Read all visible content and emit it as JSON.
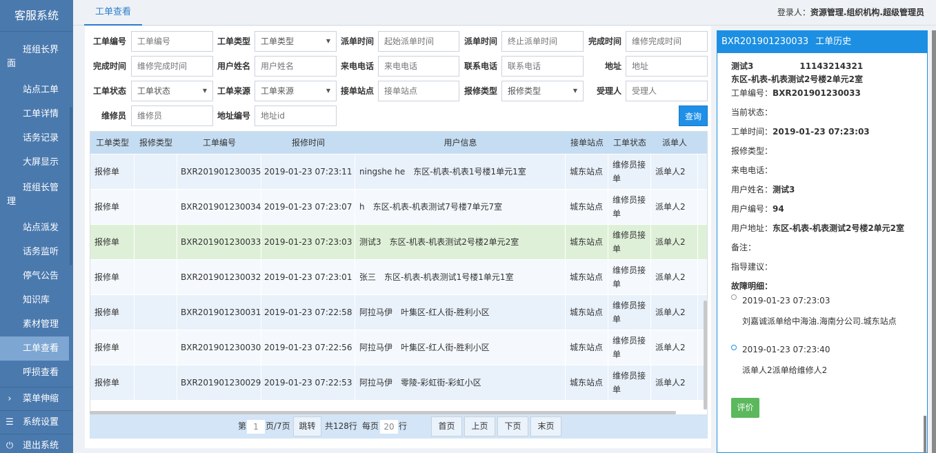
{
  "app": {
    "title": "客服系统"
  },
  "sidebar": {
    "items": [
      {
        "label": "班组长界面"
      },
      {
        "label": "站点工单"
      },
      {
        "label": "工单详情"
      },
      {
        "label": "话务记录"
      },
      {
        "label": "大屏显示"
      },
      {
        "label": "班组长管理"
      },
      {
        "label": "站点派发"
      },
      {
        "label": "话务监听"
      },
      {
        "label": "停气公告"
      },
      {
        "label": "知识库"
      },
      {
        "label": "素材管理"
      },
      {
        "label": "工单查看"
      },
      {
        "label": "呼损查看"
      }
    ],
    "bottom": {
      "menu_toggle": "菜单伸缩",
      "settings": "系统设置",
      "logout": "退出系统",
      "menu_icon": "›",
      "settings_icon": "☰",
      "logout_icon": "⏻"
    }
  },
  "topbar": {
    "tab": "工单查看",
    "login_label": "登录人：",
    "login_user": "资源管理.组织机构.超级管理员"
  },
  "filters": {
    "order_no": {
      "label": "工单编号",
      "placeholder": "工单编号"
    },
    "order_type": {
      "label": "工单类型",
      "value": "工单类型"
    },
    "dispatch_start": {
      "label": "派单时间",
      "placeholder": "起始派单时间"
    },
    "dispatch_end": {
      "label": "派单时间",
      "placeholder": "终止派单时间"
    },
    "finish_time1": {
      "label": "完成时间",
      "placeholder": "维修完成时间"
    },
    "finish_time2": {
      "label": "完成时间",
      "placeholder": "维修完成时间"
    },
    "user_name": {
      "label": "用户姓名",
      "placeholder": "用户姓名"
    },
    "incoming_phone": {
      "label": "来电电话",
      "placeholder": "来电电话"
    },
    "contact_phone": {
      "label": "联系电话",
      "placeholder": "联系电话"
    },
    "address": {
      "label": "地址",
      "placeholder": "地址"
    },
    "order_status": {
      "label": "工单状态",
      "value": "工单状态"
    },
    "order_source": {
      "label": "工单来源",
      "value": "工单来源"
    },
    "receiving_station": {
      "label": "接单站点",
      "placeholder": "接单站点"
    },
    "repair_type": {
      "label": "报修类型",
      "value": "报修类型"
    },
    "acceptor": {
      "label": "受理人",
      "placeholder": "受理人"
    },
    "repairman": {
      "label": "维修员",
      "placeholder": "维修员"
    },
    "address_id": {
      "label": "地址编号",
      "placeholder": "地址id"
    },
    "query_button": "查询"
  },
  "table": {
    "headers": [
      "工单类型",
      "报修类型",
      "工单编号",
      "报修时间",
      "用户信息",
      "接单站点",
      "工单状态",
      "派单人"
    ],
    "rows": [
      {
        "type": "报修单",
        "repair_type": "",
        "no": "BXR201901230035",
        "time": "2019-01-23 07:23:11",
        "user": "ningshe he　东区-机表-机表1号楼1单元1室",
        "station": "城东站点",
        "status": "维修员接单",
        "dispatcher": "派单人2"
      },
      {
        "type": "报修单",
        "repair_type": "",
        "no": "BXR201901230034",
        "time": "2019-01-23 07:23:07",
        "user": "h　东区-机表-机表测试7号楼7单元7室",
        "station": "城东站点",
        "status": "维修员接单",
        "dispatcher": "派单人2"
      },
      {
        "type": "报修单",
        "repair_type": "",
        "no": "BXR201901230033",
        "time": "2019-01-23 07:23:03",
        "user": "测试3　东区-机表-机表测试2号楼2单元2室",
        "station": "城东站点",
        "status": "维修员接单",
        "dispatcher": "派单人2"
      },
      {
        "type": "报修单",
        "repair_type": "",
        "no": "BXR201901230032",
        "time": "2019-01-23 07:23:01",
        "user": "张三　东区-机表-机表测试1号楼1单元1室",
        "station": "城东站点",
        "status": "维修员接单",
        "dispatcher": "派单人2"
      },
      {
        "type": "报修单",
        "repair_type": "",
        "no": "BXR201901230031",
        "time": "2019-01-23 07:22:58",
        "user": "阿拉马伊　叶集区-红人街-胜利小区",
        "station": "城东站点",
        "status": "维修员接单",
        "dispatcher": "派单人2"
      },
      {
        "type": "报修单",
        "repair_type": "",
        "no": "BXR201901230030",
        "time": "2019-01-23 07:22:56",
        "user": "阿拉马伊　叶集区-红人街-胜利小区",
        "station": "城东站点",
        "status": "维修员接单",
        "dispatcher": "派单人2"
      },
      {
        "type": "报修单",
        "repair_type": "",
        "no": "BXR201901230029",
        "time": "2019-01-23 07:22:53",
        "user": "阿拉马伊　零陵-彩虹街-彩虹小区",
        "station": "城东站点",
        "status": "维修员接单",
        "dispatcher": "派单人2"
      }
    ]
  },
  "pager": {
    "page_prefix": "第",
    "page_value": "1",
    "page_suffix": "页/7页",
    "jump": "跳转",
    "total": "共128行",
    "per_page_prefix": "每页",
    "per_page_value": "20",
    "per_page_suffix": "行",
    "first": "首页",
    "prev": "上页",
    "next": "下页",
    "last": "末页"
  },
  "history": {
    "header_no": "BXR201901230033",
    "header_title": "工单历史",
    "user_line": "测试3",
    "phone": "11143214321",
    "address_line": "东区-机表-机表测试2号楼2单元2室",
    "order_no_label": "工单编号：",
    "order_no": "BXR201901230033",
    "status_label": "当前状态：",
    "order_time_label": "工单时间：",
    "order_time": "2019-01-23 07:23:03",
    "repair_type_label": "报修类型：",
    "incoming_label": "来电电话：",
    "user_name_label": "用户姓名：",
    "user_name": "测试3",
    "user_no_label": "用户编号：",
    "user_no": "94",
    "user_addr_label": "用户地址：",
    "user_addr": "东区-机表-机表测试2号楼2单元2室",
    "remark_label": "备注：",
    "advice_label": "指导建议：",
    "fault_label": "故障明细：",
    "events": [
      {
        "time": "2019-01-23 07:23:03",
        "desc": "刘嘉诚派单给中海油.海南分公司.城东站点"
      },
      {
        "time": "2019-01-23 07:23:40",
        "desc": "派单人2派单给维修人2"
      }
    ],
    "evaluate_button": "评价"
  }
}
